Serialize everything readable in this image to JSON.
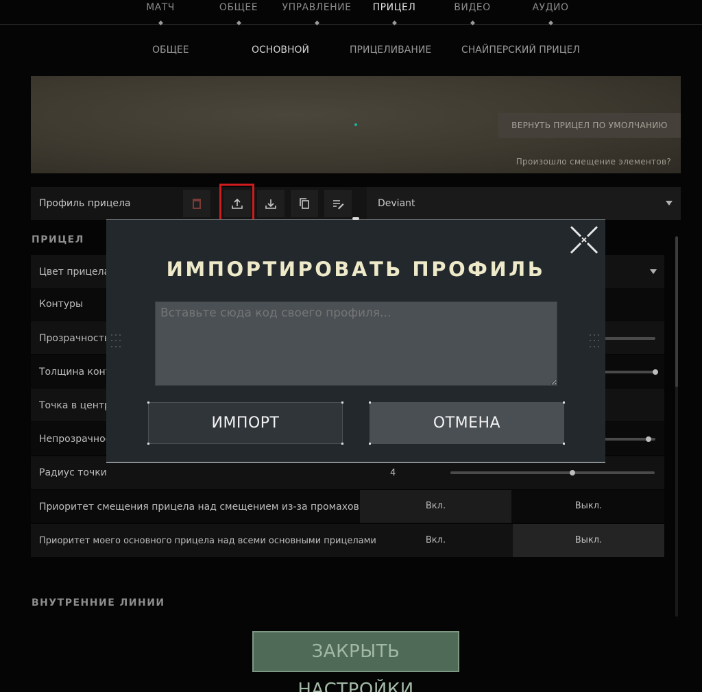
{
  "top_tabs": [
    {
      "label": "МАТЧ",
      "active": false
    },
    {
      "label": "ОБЩЕЕ",
      "active": false
    },
    {
      "label": "УПРАВЛЕНИЕ",
      "active": false
    },
    {
      "label": "ПРИЦЕЛ",
      "active": true
    },
    {
      "label": "ВИДЕО",
      "active": false
    },
    {
      "label": "АУДИО",
      "active": false
    }
  ],
  "sub_tabs": [
    {
      "label": "ОБЩЕЕ",
      "active": false
    },
    {
      "label": "ОСНОВНОЙ",
      "active": true
    },
    {
      "label": "ПРИЦЕЛИВАНИЕ",
      "active": false
    },
    {
      "label": "СНАЙПЕРСКИЙ ПРИЦЕЛ",
      "active": false
    }
  ],
  "preview": {
    "reset_label": "ВЕРНУТЬ ПРИЦЕЛ ПО УМОЛЧАНИЮ",
    "shift_question": "Произошло смещение элементов?"
  },
  "profile": {
    "label": "Профиль прицела",
    "selected": "Deviant",
    "icons": [
      "delete-icon",
      "import-icon",
      "export-icon",
      "copy-icon",
      "rename-icon"
    ]
  },
  "section_crosshair": "ПРИЦЕЛ",
  "rows": {
    "color": "Цвет прицела",
    "outlines": "Контуры",
    "transparency": "Прозрачность",
    "outline_thickness": "Толщина конт",
    "center_dot": "Точка в центр",
    "opacity": "Непрозрачнос",
    "dot_radius": "Радиус точки",
    "dot_radius_value": "4",
    "priority_firing": "Приоритет смещения прицела над смещением из-за промахов",
    "priority_primary": "Приоритет моего основного прицела над всеми основными прицелами",
    "on": "Вкл.",
    "off": "Выкл."
  },
  "sliders": {
    "transparency": 1.0,
    "outline_thickness": 1.0,
    "opacity": 0.97,
    "dot_radius": 0.6
  },
  "section_inner_lines": "ВНУТРЕННИЕ ЛИНИИ",
  "modal": {
    "title": "ИМПОРТИРОВАТЬ ПРОФИЛЬ",
    "placeholder": "Вставьте сюда код своего профиля...",
    "import_label": "ИМПОРТ",
    "cancel_label": "ОТМЕНА"
  },
  "close_settings_label": "ЗАКРЫТЬ НАСТРОЙКИ",
  "colors": {
    "accent_title": "#eeeac9",
    "highlight": "#d01c1c",
    "close_button": "#4f6a56"
  }
}
